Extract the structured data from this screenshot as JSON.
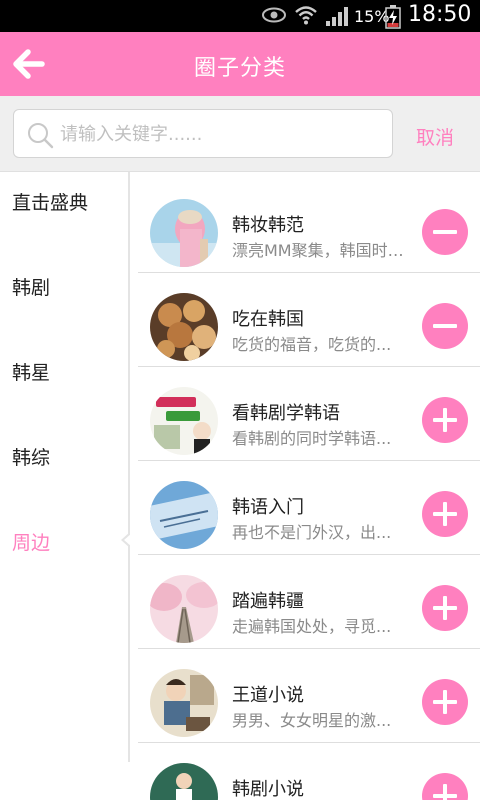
{
  "status": {
    "battery": "15%",
    "time": "18:50"
  },
  "header": {
    "title": "圈子分类"
  },
  "search": {
    "placeholder": "请输入关键字......",
    "cancel": "取消"
  },
  "sidebar": {
    "items": [
      {
        "label": "直击盛典",
        "active": false
      },
      {
        "label": "韩剧",
        "active": false
      },
      {
        "label": "韩星",
        "active": false
      },
      {
        "label": "韩综",
        "active": false
      },
      {
        "label": "周边",
        "active": true
      }
    ]
  },
  "circles": [
    {
      "name": "韩妆韩范",
      "desc": "漂亮MM聚集，韩国时尚...",
      "action": "remove",
      "icon": "remove-icon"
    },
    {
      "name": "吃在韩国",
      "desc": "吃货的福音，吃货的...",
      "action": "remove",
      "icon": "remove-icon"
    },
    {
      "name": "看韩剧学韩语",
      "desc": "看韩剧的同时学韩语...",
      "action": "add",
      "icon": "add-icon"
    },
    {
      "name": "韩语入门",
      "desc": "再也不是门外汉，出...",
      "action": "add",
      "icon": "add-icon"
    },
    {
      "name": "踏遍韩疆",
      "desc": "走遍韩国处处，寻觅...",
      "action": "add",
      "icon": "add-icon"
    },
    {
      "name": "王道小说",
      "desc": "男男、女女明星的激...",
      "action": "add",
      "icon": "add-icon"
    },
    {
      "name": "韩剧小说",
      "desc": "",
      "action": "add",
      "icon": "add-icon"
    }
  ],
  "colors": {
    "accent": "#ff80bf",
    "status_bar": "#000000",
    "search_bg": "#efefef"
  }
}
